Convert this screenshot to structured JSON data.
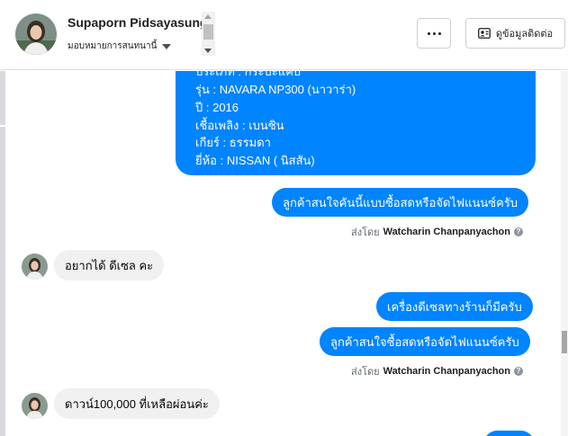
{
  "header": {
    "contact_name": "Supaporn Pidsayasung",
    "assign_label": "มอบหมายการสนทนานี้",
    "contact_info_button": "ดูข้อมูลติดต่อ"
  },
  "messages": {
    "vehicle_info": {
      "type_line": "ประเภท : กระบะแค็บ",
      "model_line": "รุ่น : NAVARA NP300 (นาวาร่า)",
      "year_line": "ปี : 2016",
      "fuel_line": "เชื้อเพลิง : เบนซิน",
      "gear_line": "เกียร์ : ธรรมดา",
      "brand_line": "ยี่ห้อ : NISSAN ( นิสสัน)"
    },
    "out_1": "ลูกค้าสนใจคันนี้แบบซื้อสดหรือจัดไฟแนนซ์ครับ",
    "sent_by_1": {
      "prefix": "ส่งโดย",
      "name": "Watcharin Chanpanyachon"
    },
    "in_1": "อยากได้ ดีเซล คะ",
    "out_2": "เครื่องดีเซลทางร้านก็มีครับ",
    "out_3": "ลูกค้าสนใจซื้อสดหรือจัดไฟแนนซ์ครับ",
    "sent_by_2": {
      "prefix": "ส่งโดย",
      "name": "Watcharin Chanpanyachon"
    },
    "in_2": "ดาวน์100,000 ที่เหลือผ่อนค่ะ"
  },
  "colors": {
    "outgoing_bubble": "#0084ff",
    "incoming_bubble": "#f1f0f0"
  },
  "icons": {
    "assign": "caret-down-icon",
    "more": "more-dots-icon",
    "contact": "contact-card-icon",
    "help": "help-circle-icon"
  }
}
